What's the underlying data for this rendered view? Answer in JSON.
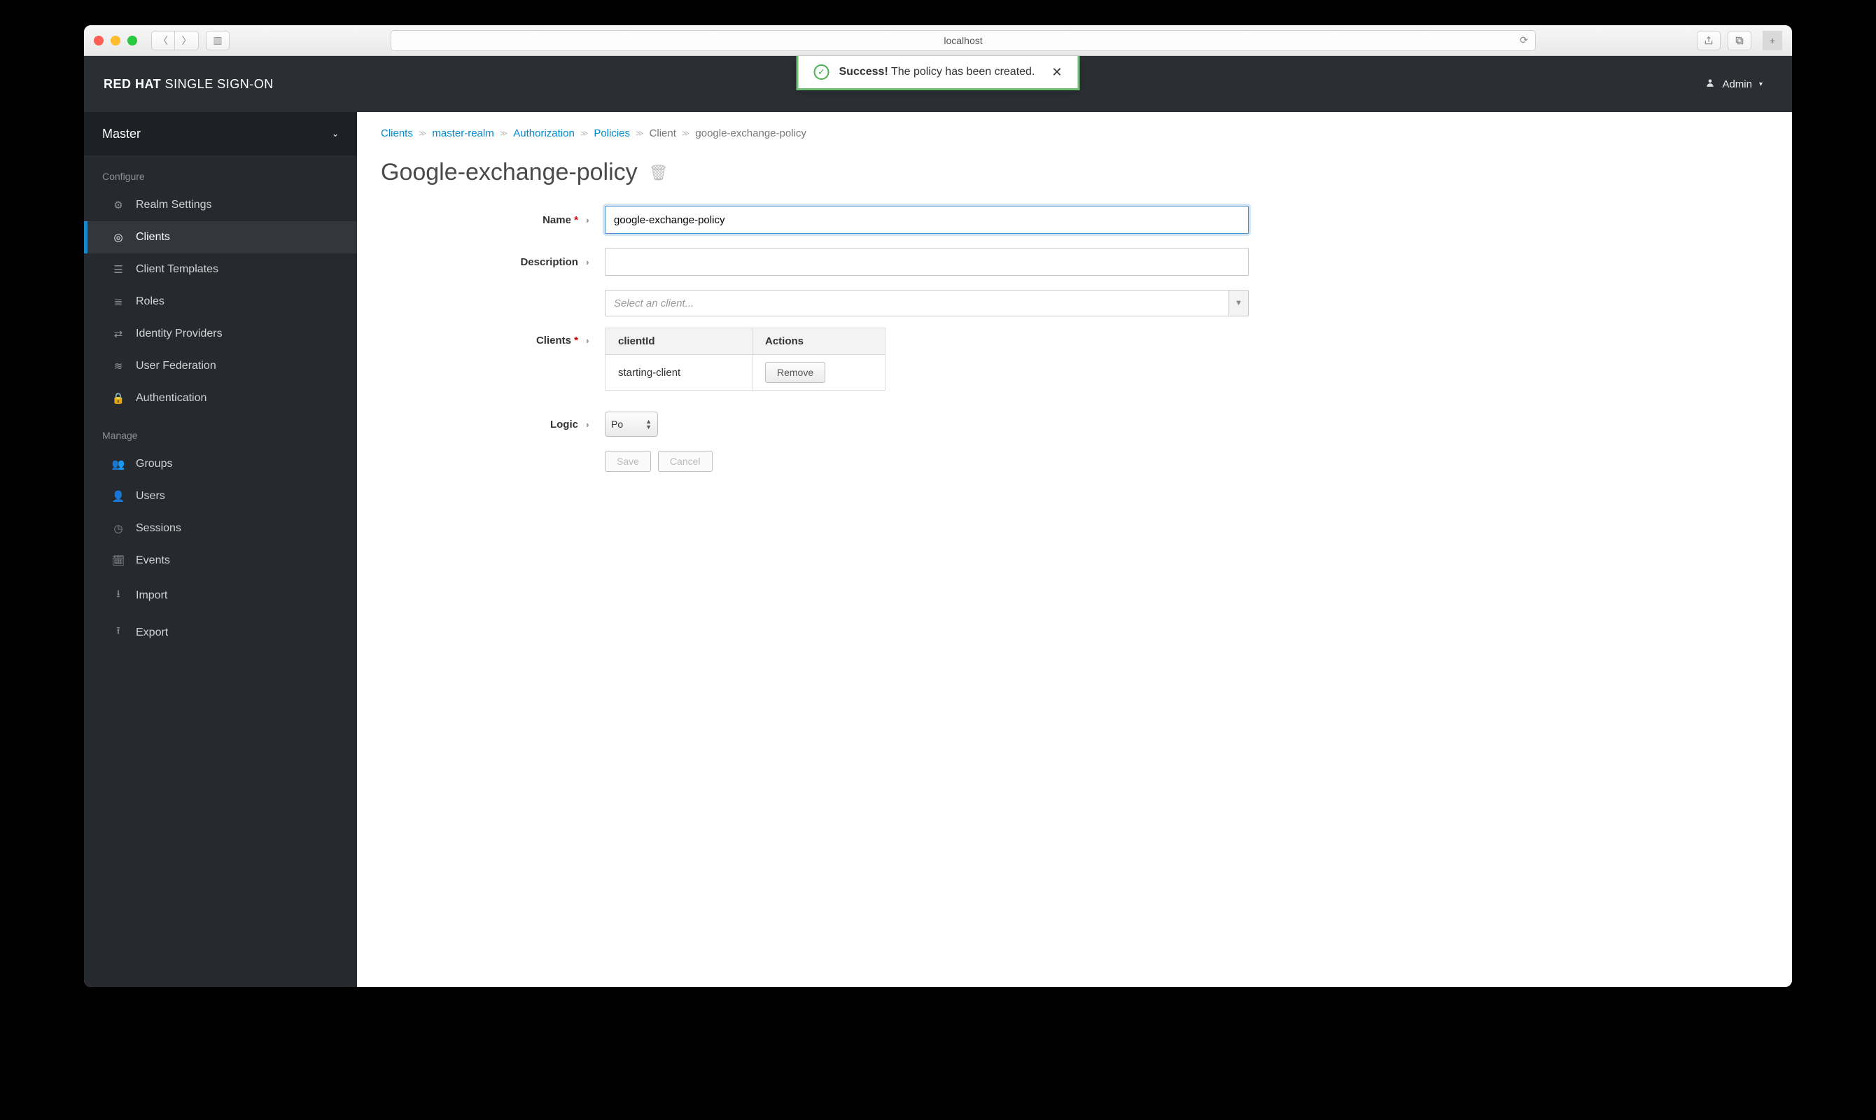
{
  "browser": {
    "address": "localhost"
  },
  "brand": {
    "bold": "RED HAT",
    "rest": " SINGLE SIGN-ON"
  },
  "toast": {
    "strong": "Success!",
    "rest": "The policy has been created."
  },
  "user": {
    "name": "Admin"
  },
  "realm": {
    "name": "Master"
  },
  "sidebar": {
    "sections": {
      "configure": "Configure",
      "manage": "Manage"
    },
    "configure_items": [
      {
        "label": "Realm Settings"
      },
      {
        "label": "Clients"
      },
      {
        "label": "Client Templates"
      },
      {
        "label": "Roles"
      },
      {
        "label": "Identity Providers"
      },
      {
        "label": "User Federation"
      },
      {
        "label": "Authentication"
      }
    ],
    "manage_items": [
      {
        "label": "Groups"
      },
      {
        "label": "Users"
      },
      {
        "label": "Sessions"
      },
      {
        "label": "Events"
      },
      {
        "label": "Import"
      },
      {
        "label": "Export"
      }
    ]
  },
  "breadcrumb": {
    "items": [
      {
        "label": "Clients",
        "link": true
      },
      {
        "label": "master-realm",
        "link": true
      },
      {
        "label": "Authorization",
        "link": true
      },
      {
        "label": "Policies",
        "link": true
      },
      {
        "label": "Client",
        "link": false
      },
      {
        "label": "google-exchange-policy",
        "link": false
      }
    ]
  },
  "page": {
    "title": "Google-exchange-policy"
  },
  "form": {
    "labels": {
      "name": "Name",
      "description": "Description",
      "clients": "Clients",
      "logic": "Logic"
    },
    "name_value": "google-exchange-policy",
    "description_value": "",
    "clients_placeholder": "Select an client...",
    "logic_value": "Po",
    "table": {
      "headers": {
        "clientId": "clientId",
        "actions": "Actions"
      },
      "rows": [
        {
          "clientId": "starting-client",
          "action": "Remove"
        }
      ]
    },
    "buttons": {
      "save": "Save",
      "cancel": "Cancel"
    }
  }
}
